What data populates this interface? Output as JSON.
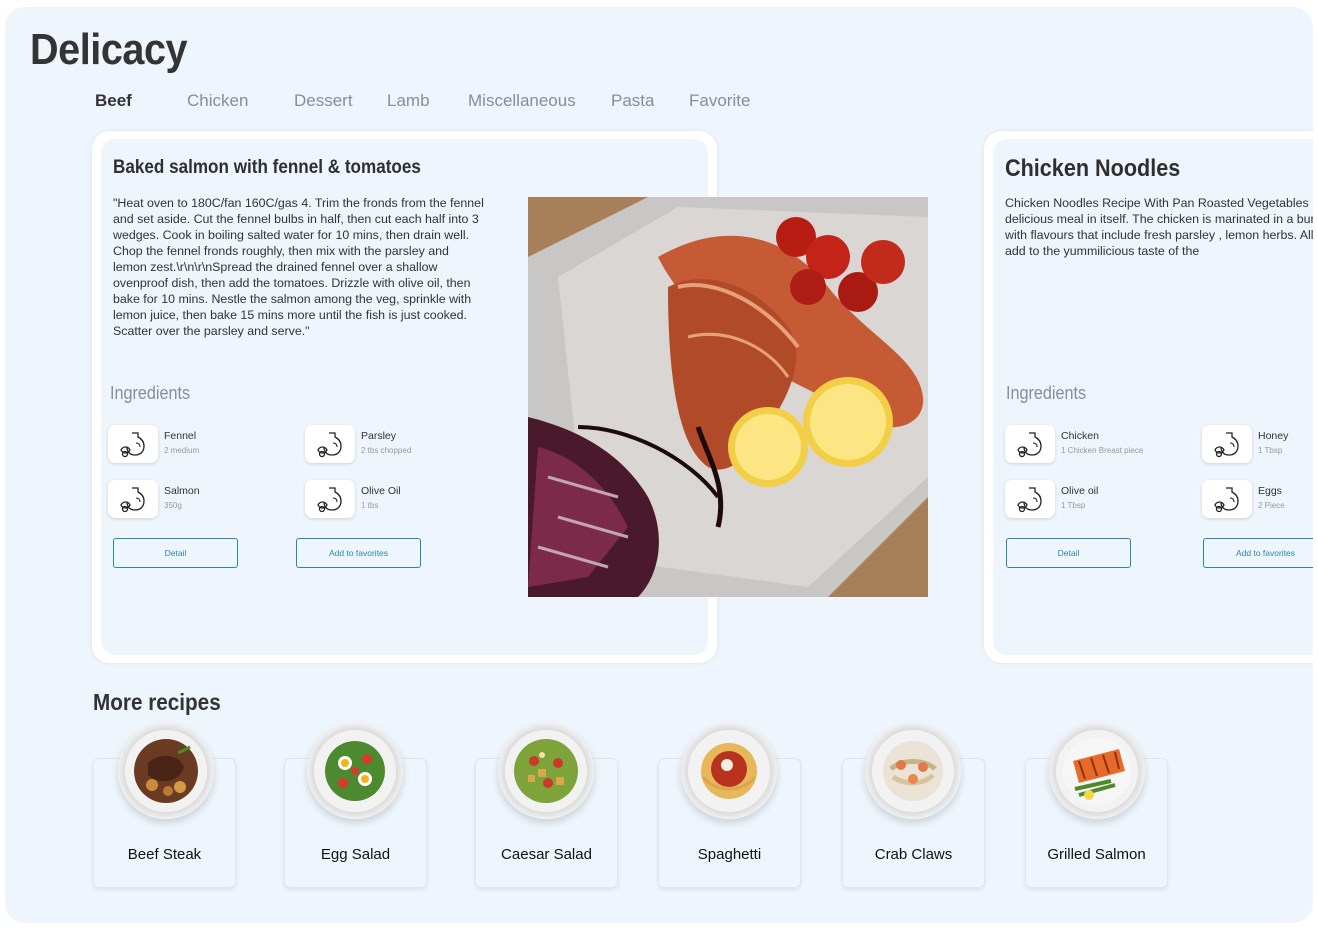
{
  "app": {
    "title": "Delicacy"
  },
  "tabs": [
    "Beef",
    "Chicken",
    "Dessert",
    "Lamb",
    "Miscellaneous",
    "Pasta",
    "Favorite"
  ],
  "active_tab": "Beef",
  "featured": {
    "title": "Baked salmon with fennel & tomatoes",
    "description": "\"Heat oven to 180C/fan 160C/gas 4. Trim the fronds from the fennel and set aside. Cut the fennel bulbs in half, then cut each half into 3 wedges. Cook in boiling salted water for 10 mins, then drain well. Chop the fennel fronds roughly, then mix with the parsley and lemon zest.\\r\\n\\r\\nSpread the drained fennel over a shallow ovenproof dish, then add the tomatoes. Drizzle with olive oil, then bake for 10 mins. Nestle the salmon among the veg, sprinkle with lemon juice, then bake 15 mins more until the fish is just cooked. Scatter over the parsley and serve.\"",
    "ingredients_heading": "Ingredients",
    "ingredients": [
      {
        "name": "Fennel",
        "amount": "2 medium",
        "icon": "ingredient-bottle-icon"
      },
      {
        "name": "Parsley",
        "amount": "2 tbs chopped",
        "icon": "ingredient-bottle-icon"
      },
      {
        "name": "Salmon",
        "amount": "350g",
        "icon": "ingredient-bottle-icon"
      },
      {
        "name": "Olive Oil",
        "amount": "1 tbs",
        "icon": "ingredient-bottle-icon"
      }
    ],
    "detail_label": "Detail",
    "favorite_label": "Add to favorites"
  },
  "second": {
    "title": "Chicken Noodles",
    "description": "Chicken Noodles Recipe With Pan Roasted Vegetables is a delicious meal in itself. The chicken is marinated in a bursting with flavours that include fresh parsley , lemon herbs. All of which add to the yummilicious taste of the",
    "ingredients_heading": "Ingredients",
    "ingredients": [
      {
        "name": "Chicken",
        "amount": "1 Chicken Breast piece",
        "icon": "ingredient-bottle-icon"
      },
      {
        "name": "Honey",
        "amount": "1 Tbsp",
        "icon": "ingredient-bottle-icon"
      },
      {
        "name": "Olive oil",
        "amount": "1 Tbsp",
        "icon": "ingredient-bottle-icon"
      },
      {
        "name": "Eggs",
        "amount": "2 Piece",
        "icon": "ingredient-bottle-icon"
      }
    ],
    "detail_label": "Detail",
    "favorite_label": "Add to favorites"
  },
  "more": {
    "heading": "More recipes",
    "items": [
      {
        "label": "Beef Steak"
      },
      {
        "label": "Egg Salad"
      },
      {
        "label": "Caesar Salad"
      },
      {
        "label": "Spaghetti"
      },
      {
        "label": "Crab Claws"
      },
      {
        "label": "Grilled Salmon"
      }
    ]
  },
  "colors": {
    "background": "#eef5fd",
    "accent": "#2a86a8",
    "title": "#343434",
    "muted": "#8a8d93"
  }
}
